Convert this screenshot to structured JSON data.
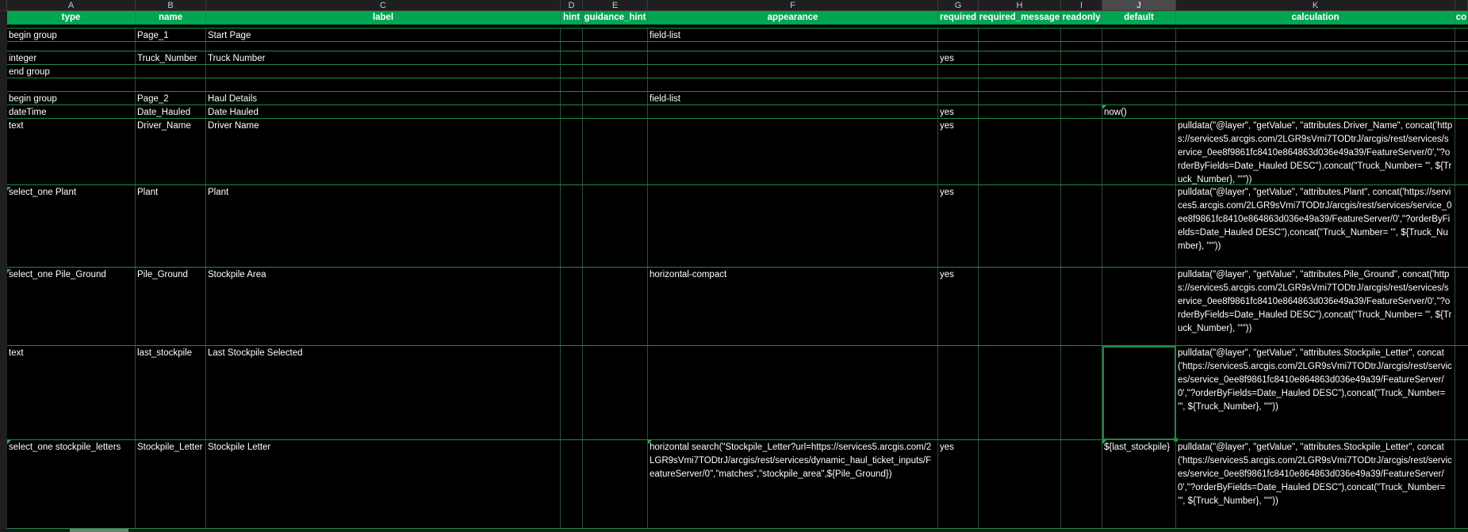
{
  "columns": [
    "A",
    "B",
    "C",
    "D",
    "E",
    "F",
    "G",
    "H",
    "I",
    "J",
    "K"
  ],
  "headers": [
    "type",
    "name",
    "label",
    "hint",
    "guidance_hint",
    "appearance",
    "required",
    "required_message",
    "readonly",
    "default",
    "calculation",
    "co"
  ],
  "rows": [
    {
      "type": "begin group",
      "name": "Page_1",
      "label": "Start Page",
      "appearance": "field-list"
    },
    {},
    {
      "type": "integer",
      "name": "Truck_Number",
      "label": "Truck Number",
      "required": "yes"
    },
    {
      "type": "end group"
    },
    {},
    {
      "type": "begin group",
      "name": "Page_2",
      "label": "Haul Details",
      "appearance": "field-list"
    },
    {
      "type": "dateTime",
      "name": "Date_Hauled",
      "label": "Date Hauled",
      "required": "yes",
      "default": "now()"
    },
    {
      "type": "text",
      "name": "Driver_Name",
      "label": "Driver Name",
      "required": "yes",
      "calculation": "pulldata(\"@layer\", \"getValue\", \"attributes.Driver_Name\", concat('https://services5.arcgis.com/2LGR9sVmi7TODtrJ/arcgis/rest/services/service_0ee8f9861fc8410e864863d036e49a39/FeatureServer/0',\"?orderByFields=Date_Hauled DESC\"),concat(\"Truck_Number= '\", ${Truck_Number}, \"'\"))"
    },
    {
      "type": "select_one Plant",
      "name": "Plant",
      "label": "Plant",
      "required": "yes",
      "calculation": "pulldata(\"@layer\", \"getValue\", \"attributes.Plant\", concat('https://services5.arcgis.com/2LGR9sVmi7TODtrJ/arcgis/rest/services/service_0ee8f9861fc8410e864863d036e49a39/FeatureServer/0',\"?orderByFields=Date_Hauled DESC\"),concat(\"Truck_Number= '\", ${Truck_Number}, \"'\"))"
    },
    {
      "type": "select_one Pile_Ground",
      "name": "Pile_Ground",
      "label": "Stockpile Area",
      "appearance": "horizontal-compact",
      "required": "yes",
      "calculation": "pulldata(\"@layer\", \"getValue\", \"attributes.Pile_Ground\", concat('https://services5.arcgis.com/2LGR9sVmi7TODtrJ/arcgis/rest/services/service_0ee8f9861fc8410e864863d036e49a39/FeatureServer/0',\"?orderByFields=Date_Hauled DESC\"),concat(\"Truck_Number= '\", ${Truck_Number}, \"'\"))"
    },
    {
      "type": "text",
      "name": "last_stockpile",
      "label": "Last Stockpile Selected",
      "calculation": "pulldata(\"@layer\", \"getValue\", \"attributes.Stockpile_Letter\", concat('https://services5.arcgis.com/2LGR9sVmi7TODtrJ/arcgis/rest/services/service_0ee8f9861fc8410e864863d036e49a39/FeatureServer/0',\"?orderByFields=Date_Hauled DESC\"),concat(\"Truck_Number= '\", ${Truck_Number}, \"'\"))"
    },
    {
      "type": "select_one stockpile_letters",
      "name": "Stockpile_Letter",
      "label": "Stockpile Letter",
      "appearance": "horizontal search(\"Stockpile_Letter?url=https://services5.arcgis.com/2LGR9sVmi7TODtrJ/arcgis/rest/services/dynamic_haul_ticket_inputs/FeatureServer/0\",\"matches\",\"stockpile_area\",${Pile_Ground})",
      "required": "yes",
      "default": "${last_stockpile}",
      "calculation": "pulldata(\"@layer\", \"getValue\", \"attributes.Stockpile_Letter\", concat('https://services5.arcgis.com/2LGR9sVmi7TODtrJ/arcgis/rest/services/service_0ee8f9861fc8410e864863d036e49a39/FeatureServer/0',\"?orderByFields=Date_Hauled DESC\"),concat(\"Truck_Number= '\", ${Truck_Number}, \"'\"))"
    }
  ]
}
